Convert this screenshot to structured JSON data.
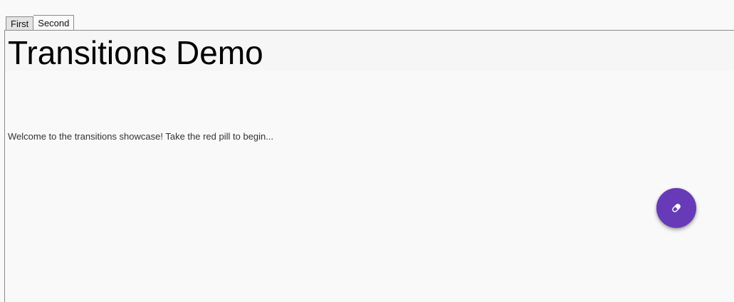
{
  "tabs": [
    {
      "label": "First",
      "active": false
    },
    {
      "label": "Second",
      "active": true
    }
  ],
  "appbar": {
    "title": "Transitions Demo"
  },
  "main": {
    "welcome_text": "Welcome to the transitions showcase! Take the red pill to begin..."
  },
  "fab": {
    "icon": "pill-icon",
    "color": "#673ab7"
  },
  "colors": {
    "background": "#f9f9f9",
    "accent": "#673ab7"
  }
}
